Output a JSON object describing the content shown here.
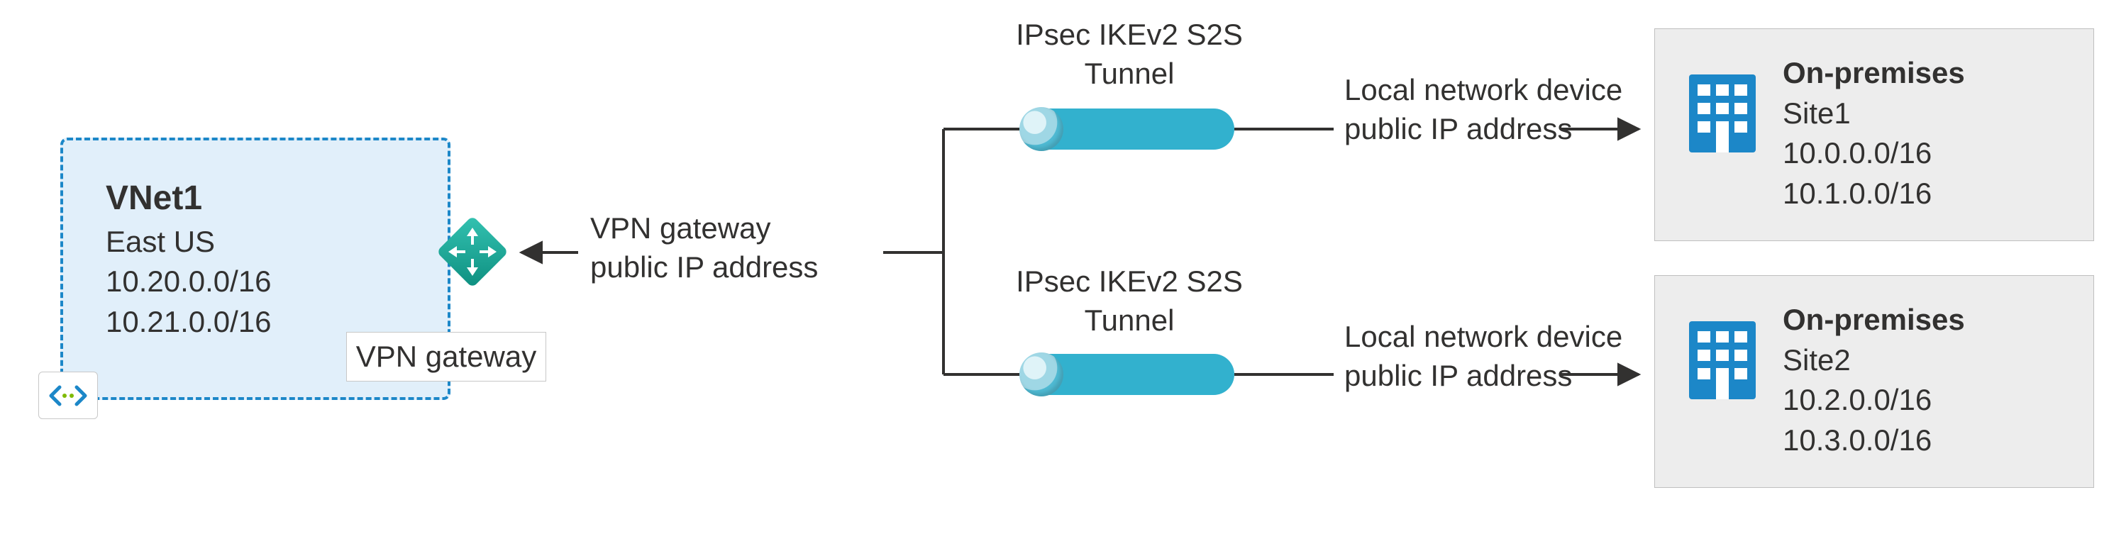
{
  "vnet": {
    "title": "VNet1",
    "region": "East US",
    "cidr1": "10.20.0.0/16",
    "cidr2": "10.21.0.0/16"
  },
  "vpn_gateway": {
    "caption": "VPN gateway",
    "label_line1": "VPN gateway",
    "label_line2": "public IP address"
  },
  "tunnels": {
    "top": {
      "line1": "IPsec IKEv2 S2S",
      "line2": "Tunnel"
    },
    "bottom": {
      "line1": "IPsec IKEv2 S2S",
      "line2": "Tunnel"
    }
  },
  "local_device": {
    "top": {
      "line1": "Local network device",
      "line2": "public IP address"
    },
    "bottom": {
      "line1": "Local network device",
      "line2": "public IP address"
    }
  },
  "sites": {
    "site1": {
      "title": "On-premises",
      "name": "Site1",
      "cidr1": "10.0.0.0/16",
      "cidr2": "10.1.0.0/16"
    },
    "site2": {
      "title": "On-premises",
      "name": "Site2",
      "cidr1": "10.2.0.0/16",
      "cidr2": "10.3.0.0/16"
    }
  },
  "icons": {
    "vnet_badge": "code-chevrons-icon",
    "gateway": "vpn-gateway-diamond-icon",
    "building": "building-icon"
  }
}
